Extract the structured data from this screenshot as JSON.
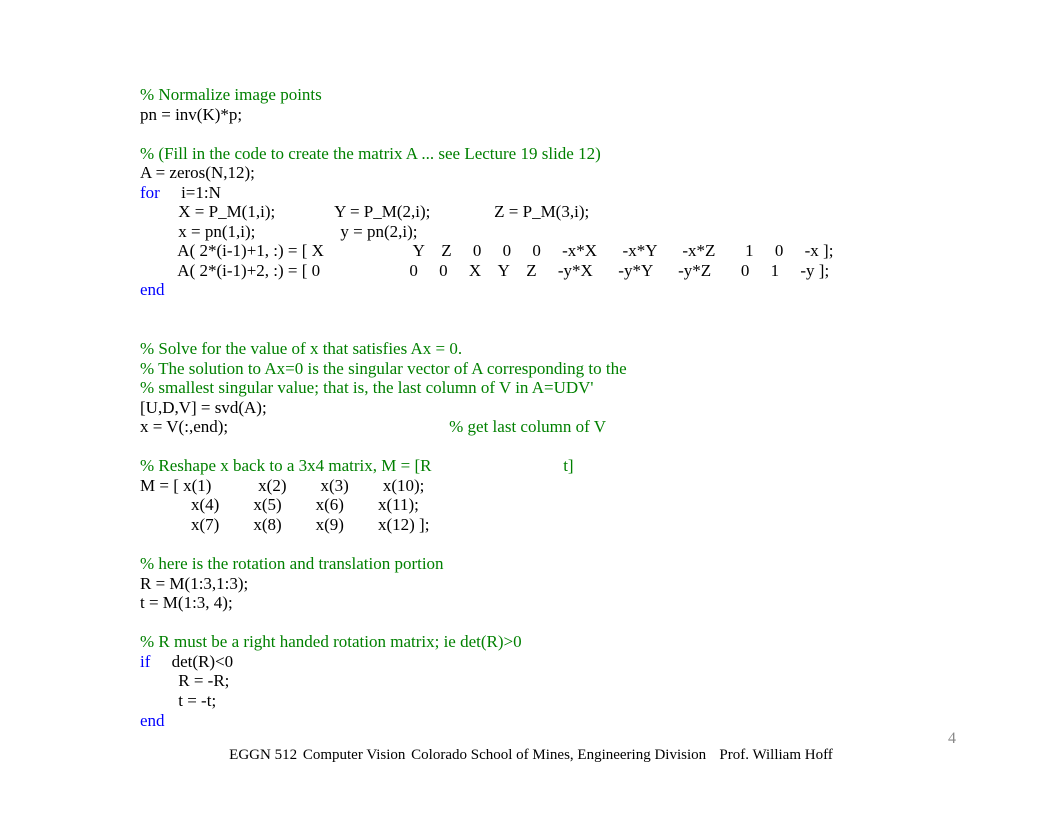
{
  "lines": [
    {
      "parts": [
        {
          "cls": "comment",
          "t": "% Normalize image points"
        }
      ]
    },
    {
      "parts": [
        {
          "cls": "normal",
          "t": "pn = inv(K)*p;"
        }
      ]
    },
    {
      "parts": [
        {
          "cls": "normal",
          "t": ""
        }
      ]
    },
    {
      "parts": [
        {
          "cls": "comment",
          "t": "% (Fill in the code to create the matrix A ... see Lecture 19 slide 12)"
        }
      ]
    },
    {
      "parts": [
        {
          "cls": "normal",
          "t": "A = zeros(N,12);"
        }
      ]
    },
    {
      "parts": [
        {
          "cls": "keyword",
          "t": "for"
        },
        {
          "cls": "normal",
          "t": "     i=1:N"
        }
      ]
    },
    {
      "parts": [
        {
          "cls": "normal",
          "t": "         X = P_M(1,i);              Y = P_M(2,i);               Z = P_M(3,i);"
        }
      ]
    },
    {
      "parts": [
        {
          "cls": "normal",
          "t": "         x = pn(1,i);                    y = pn(2,i);"
        }
      ]
    },
    {
      "parts": [
        {
          "cls": "normal",
          "t": "         A( 2*(i-1)+1, :) = [ X                     Y    Z     0     0     0     -x*X      -x*Y      -x*Z       1     0     -x ];"
        }
      ]
    },
    {
      "parts": [
        {
          "cls": "normal",
          "t": "         A( 2*(i-1)+2, :) = [ 0                     0     0     X    Y    Z     -y*X      -y*Y      -y*Z       0     1     -y ];"
        }
      ]
    },
    {
      "parts": [
        {
          "cls": "keyword",
          "t": "end"
        }
      ]
    },
    {
      "parts": [
        {
          "cls": "normal",
          "t": ""
        }
      ]
    },
    {
      "parts": [
        {
          "cls": "normal",
          "t": ""
        }
      ]
    },
    {
      "parts": [
        {
          "cls": "comment",
          "t": "% Solve for the value of x that satisfies Ax = 0."
        }
      ]
    },
    {
      "parts": [
        {
          "cls": "comment",
          "t": "% The solution to Ax=0 is the singular vector of A corresponding to the"
        }
      ]
    },
    {
      "parts": [
        {
          "cls": "comment",
          "t": "% smallest singular value; that is, the last column of V in A=UDV'"
        }
      ]
    },
    {
      "parts": [
        {
          "cls": "normal",
          "t": "[U,D,V] = svd(A);"
        }
      ]
    },
    {
      "parts": [
        {
          "cls": "normal",
          "t": "x = V(:,end);                                                    "
        },
        {
          "cls": "comment",
          "t": "% get last column of V"
        }
      ]
    },
    {
      "parts": [
        {
          "cls": "normal",
          "t": ""
        }
      ]
    },
    {
      "parts": [
        {
          "cls": "comment",
          "t": "% Reshape x back to a 3x4 matrix, M = [R                               t]"
        }
      ]
    },
    {
      "parts": [
        {
          "cls": "normal",
          "t": "M = [ x(1)           x(2)        x(3)        x(10);"
        }
      ]
    },
    {
      "parts": [
        {
          "cls": "normal",
          "t": "            x(4)        x(5)        x(6)        x(11);"
        }
      ]
    },
    {
      "parts": [
        {
          "cls": "normal",
          "t": "            x(7)        x(8)        x(9)        x(12) ];"
        }
      ]
    },
    {
      "parts": [
        {
          "cls": "normal",
          "t": ""
        }
      ]
    },
    {
      "parts": [
        {
          "cls": "comment",
          "t": "% here is the rotation and translation portion"
        }
      ]
    },
    {
      "parts": [
        {
          "cls": "normal",
          "t": "R = M(1:3,1:3);"
        }
      ]
    },
    {
      "parts": [
        {
          "cls": "normal",
          "t": "t = M(1:3, 4);"
        }
      ]
    },
    {
      "parts": [
        {
          "cls": "normal",
          "t": ""
        }
      ]
    },
    {
      "parts": [
        {
          "cls": "comment",
          "t": "% R must be a right handed rotation matrix; ie det(R)>0"
        }
      ]
    },
    {
      "parts": [
        {
          "cls": "keyword",
          "t": "if"
        },
        {
          "cls": "normal",
          "t": "     det(R)<0"
        }
      ]
    },
    {
      "parts": [
        {
          "cls": "normal",
          "t": "         R = -R;"
        }
      ]
    },
    {
      "parts": [
        {
          "cls": "normal",
          "t": "         t = -t;"
        }
      ]
    },
    {
      "parts": [
        {
          "cls": "keyword",
          "t": "end"
        }
      ]
    }
  ],
  "footer": {
    "course": "EGGN 512",
    "title": "Computer Vision",
    "org": "Colorado School of Mines, Engineering Division",
    "prof": "Prof. William Hoff"
  },
  "page_number": "4"
}
